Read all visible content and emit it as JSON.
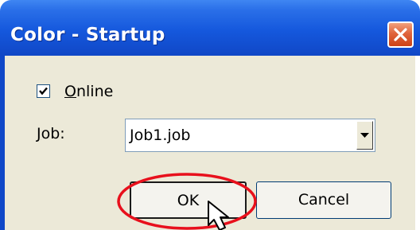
{
  "window": {
    "title": "Color - Startup",
    "close_icon": "close-icon"
  },
  "online": {
    "label": "Online",
    "checked": true
  },
  "job": {
    "label": "Job:",
    "value": "Job1.job"
  },
  "buttons": {
    "ok_label": "OK",
    "cancel_label": "Cancel"
  },
  "annotation": {
    "highlight_color": "#e8101c",
    "cursor_icon": "mouse-pointer-icon"
  }
}
